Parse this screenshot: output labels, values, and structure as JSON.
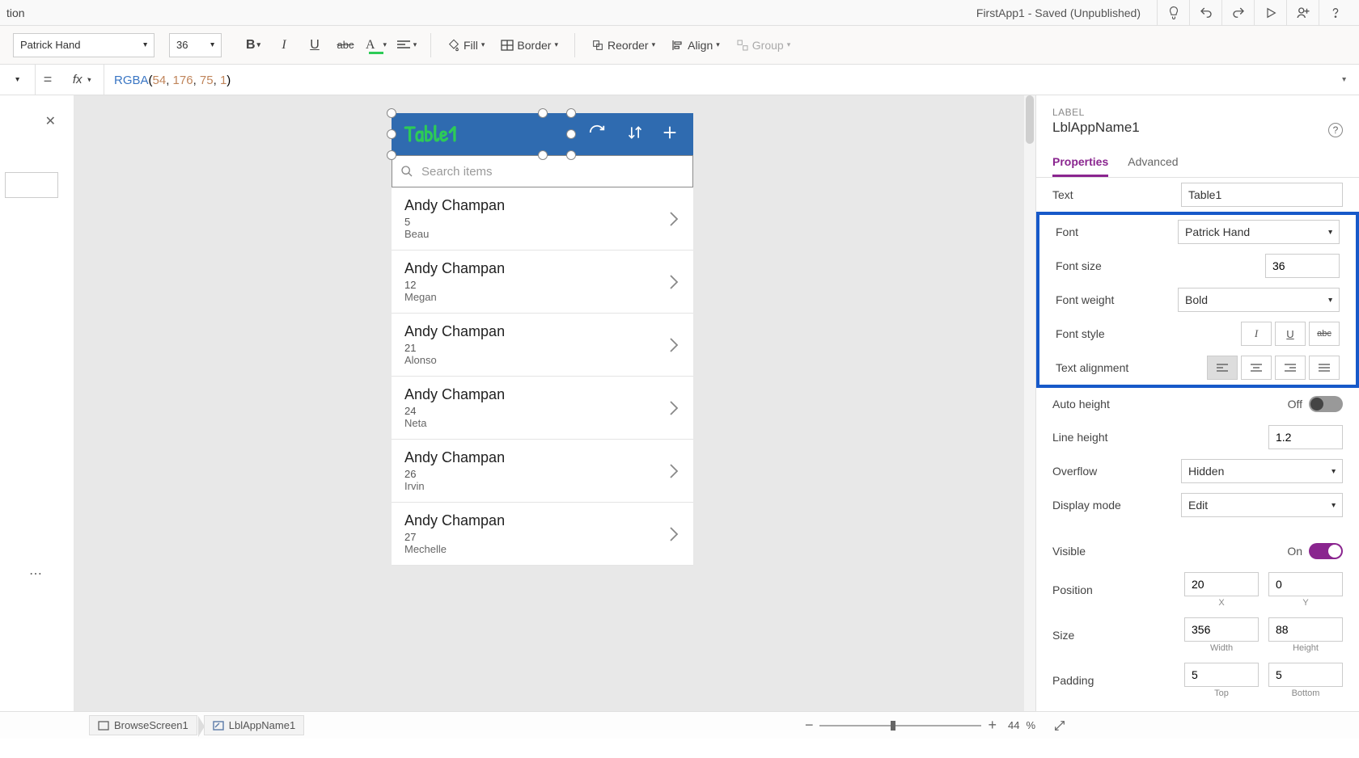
{
  "titlebar": {
    "left_fragment": "tion",
    "center": "FirstApp1 - Saved (Unpublished)"
  },
  "toolbar": {
    "font": "Patrick Hand",
    "font_size": "36",
    "fill_label": "Fill",
    "border_label": "Border",
    "reorder_label": "Reorder",
    "align_label": "Align",
    "group_label": "Group"
  },
  "formula": {
    "value_display": "RGBA(54, 176, 75, 1)"
  },
  "app": {
    "title": "Table1",
    "search_placeholder": "Search items",
    "items": [
      {
        "title": "Andy Champan",
        "sub1": "5",
        "sub2": "Beau"
      },
      {
        "title": "Andy Champan",
        "sub1": "12",
        "sub2": "Megan"
      },
      {
        "title": "Andy Champan",
        "sub1": "21",
        "sub2": "Alonso"
      },
      {
        "title": "Andy Champan",
        "sub1": "24",
        "sub2": "Neta"
      },
      {
        "title": "Andy Champan",
        "sub1": "26",
        "sub2": "Irvin"
      },
      {
        "title": "Andy Champan",
        "sub1": "27",
        "sub2": "Mechelle"
      }
    ]
  },
  "panel": {
    "type": "LABEL",
    "name": "LblAppName1",
    "tabs": {
      "properties": "Properties",
      "advanced": "Advanced"
    },
    "text_label": "Text",
    "text_value": "Table1",
    "font_label": "Font",
    "font_value": "Patrick Hand",
    "fontsize_label": "Font size",
    "fontsize_value": "36",
    "fontweight_label": "Font weight",
    "fontweight_value": "Bold",
    "fontstyle_label": "Font style",
    "textalign_label": "Text alignment",
    "autoheight_label": "Auto height",
    "autoheight_state": "Off",
    "lineheight_label": "Line height",
    "lineheight_value": "1.2",
    "overflow_label": "Overflow",
    "overflow_value": "Hidden",
    "displaymode_label": "Display mode",
    "displaymode_value": "Edit",
    "visible_label": "Visible",
    "visible_state": "On",
    "position_label": "Position",
    "pos_x": "20",
    "pos_y": "0",
    "x_lbl": "X",
    "y_lbl": "Y",
    "size_label": "Size",
    "width": "356",
    "height": "88",
    "w_lbl": "Width",
    "h_lbl": "Height",
    "padding_label": "Padding",
    "pad_top": "5",
    "pad_bottom": "5",
    "top_lbl": "Top",
    "bottom_lbl": "Bottom"
  },
  "statusbar": {
    "bc1": "BrowseScreen1",
    "bc2": "LblAppName1",
    "zoom": "44",
    "pct": "%"
  }
}
